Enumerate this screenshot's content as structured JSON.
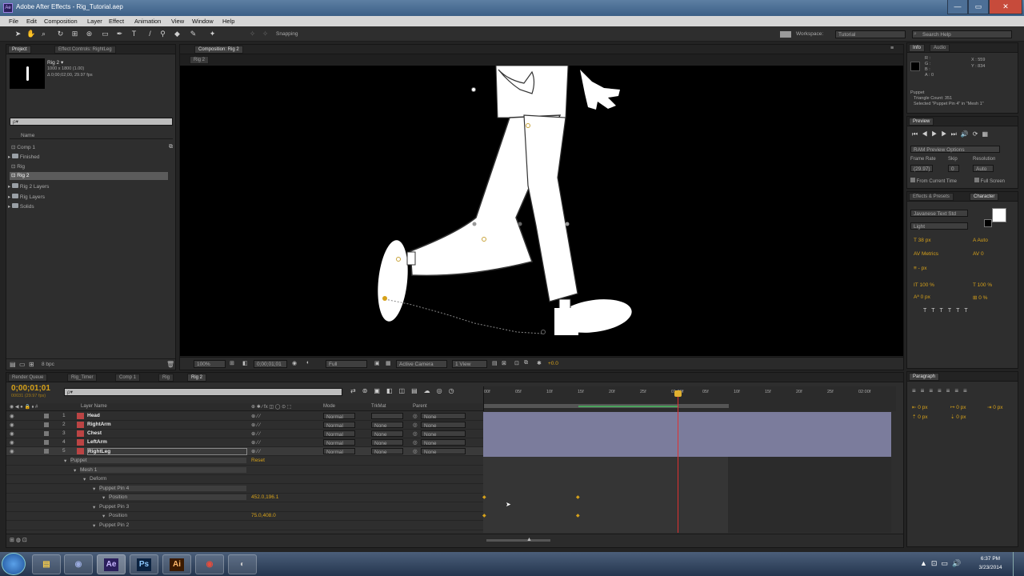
{
  "window": {
    "title": "Adobe After Effects - Rig_Tutorial.aep",
    "minimize": "—",
    "maximize": "▭",
    "close": "✕"
  },
  "menu": [
    "File",
    "Edit",
    "Composition",
    "Layer",
    "Effect",
    "Animation",
    "View",
    "Window",
    "Help"
  ],
  "toolbar": {
    "snapping": "Snapping",
    "workspace_label": "Workspace:",
    "workspace_value": "Tutorial",
    "search_placeholder": "Search Help"
  },
  "project": {
    "tab_project": "Project",
    "tab_effect": "Effect Controls: RightLeg",
    "item_name": "Rig 2 ▾",
    "item_size": "1000 x 1800 (1.00)",
    "item_duration": "Δ 0;00;02;00, 29.97 fps",
    "search_placeholder": "ρ▾",
    "column_name": "Name",
    "items": [
      "Comp 1",
      "Finished",
      "Rig",
      "Rig 2",
      "Rig 2 Layers",
      "Rig Layers",
      "Solids"
    ],
    "bpc": "8 bpc"
  },
  "composition": {
    "tab": "Composition: Rig 2",
    "breadcrumb": "Rig 2",
    "zoom": "100%",
    "time": "0;00;01;01",
    "resolution": "Full",
    "camera": "Active Camera",
    "views": "1 View",
    "exposure": "+0.0"
  },
  "info": {
    "tab_info": "Info",
    "tab_audio": "Audio",
    "r": "R :",
    "g": "G :",
    "b": "B :",
    "a": "A : 0",
    "x": "X : 559",
    "y": "Y : 834",
    "puppet": "Puppet",
    "triangle": "Triangle Count: 351",
    "selected": "Selected \"Puppet Pin 4\" in \"Mesh 1\""
  },
  "preview": {
    "tab": "Preview",
    "ram": "RAM Preview Options",
    "frame_rate_label": "Frame Rate",
    "skip_label": "Skip",
    "resolution_label": "Resolution",
    "frame_rate": "(29.97)",
    "skip": "0",
    "resolution": "Auto",
    "from_current": "From Current Time",
    "full_screen": "Full Screen"
  },
  "character": {
    "tab_effects": "Effects & Presets",
    "tab_character": "Character",
    "font": "Javanese Text Std",
    "style": "Light",
    "size": "38 px",
    "leading": "Auto",
    "kerning": "Metrics",
    "tracking": "0",
    "stroke": "- px",
    "vscale": "100 %",
    "hscale": "100 %",
    "baseline": "0 px",
    "tsume": "0 %"
  },
  "paragraph": {
    "tab": "Paragraph",
    "indent1": "0 px",
    "indent2": "0 px",
    "indent3": "0 px",
    "space1": "0 px",
    "space2": "0 px"
  },
  "timeline": {
    "tabs": [
      "Render Queue",
      "Rig_Timer",
      "Comp 1",
      "Rig",
      "Rig 2"
    ],
    "timecode": "0;00;01;01",
    "frames": "00031 (29.97 fps)",
    "search_placeholder": "ρ▾",
    "col_layer_name": "Layer Name",
    "col_mode": "Mode",
    "col_trkmat": "TrkMat",
    "col_parent": "Parent",
    "layers": [
      {
        "num": "1",
        "name": "Head",
        "mode": "Normal",
        "trk": "",
        "parent": "None"
      },
      {
        "num": "2",
        "name": "RightArm",
        "mode": "Normal",
        "trk": "None",
        "parent": "None"
      },
      {
        "num": "3",
        "name": "Chest",
        "mode": "Normal",
        "trk": "None",
        "parent": "None"
      },
      {
        "num": "4",
        "name": "LeftArm",
        "mode": "Normal",
        "trk": "None",
        "parent": "None"
      },
      {
        "num": "5",
        "name": "RightLeg",
        "mode": "Normal",
        "trk": "None",
        "parent": "None"
      }
    ],
    "props": [
      {
        "name": "Puppet",
        "value": "Reset"
      },
      {
        "name": "Mesh 1",
        "value": ""
      },
      {
        "name": "Deform",
        "value": ""
      },
      {
        "name": "Puppet Pin 4",
        "value": ""
      },
      {
        "name": "Position",
        "value": "452.0,196.1"
      },
      {
        "name": "Puppet Pin 3",
        "value": ""
      },
      {
        "name": "Position",
        "value": "75.0,408.0"
      },
      {
        "name": "Puppet Pin 2",
        "value": ""
      }
    ],
    "ruler": [
      "00f",
      "05f",
      "10f",
      "15f",
      "20f",
      "25f",
      "01:00f",
      "05f",
      "10f",
      "15f",
      "20f",
      "25f",
      "02:00f"
    ]
  },
  "taskbar": {
    "apps": [
      "Explorer",
      "Chrome",
      "Ae",
      "Ps",
      "Ai",
      "Chrome",
      "Media"
    ],
    "time": "6:37 PM",
    "date": "3/23/2014"
  },
  "colors": {
    "accent": "#d6a11a",
    "layer_bar": "#7b7c9c",
    "playhead": "#e03030",
    "work_area": "#4aa35c"
  }
}
